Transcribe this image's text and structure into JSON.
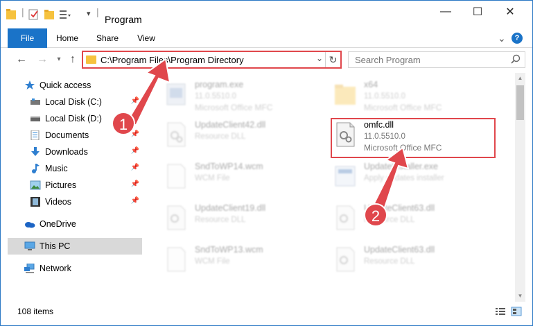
{
  "window": {
    "title": "Program",
    "minimize": "—",
    "maximize": "☐",
    "close": "✕"
  },
  "ribbon": {
    "tabs": [
      "File",
      "Home",
      "Share",
      "View"
    ],
    "help": "?"
  },
  "address": {
    "path": "C:\\Program Files\\Program Directory"
  },
  "search": {
    "placeholder": "Search Program"
  },
  "navpane": {
    "items": [
      {
        "label": "Quick access",
        "icon": "star-icon",
        "pinned": false
      },
      {
        "label": "Local Disk (C:)",
        "icon": "drive-icon",
        "pinned": true
      },
      {
        "label": "Local Disk (D:)",
        "icon": "drive-icon",
        "pinned": true
      },
      {
        "label": "Documents",
        "icon": "documents-icon",
        "pinned": true
      },
      {
        "label": "Downloads",
        "icon": "download-icon",
        "pinned": true
      },
      {
        "label": "Music",
        "icon": "music-icon",
        "pinned": true
      },
      {
        "label": "Pictures",
        "icon": "pictures-icon",
        "pinned": true
      },
      {
        "label": "Videos",
        "icon": "videos-icon",
        "pinned": true
      },
      {
        "label": "OneDrive",
        "icon": "cloud-icon",
        "pinned": false
      },
      {
        "label": "This PC",
        "icon": "computer-icon",
        "pinned": false
      },
      {
        "label": "Network",
        "icon": "network-icon",
        "pinned": false
      }
    ],
    "selected": "This PC"
  },
  "files": [
    {
      "name": "program.exe",
      "line2": "11.0.5510.0",
      "line3": "Microsoft Office MFC",
      "icon": "exe-icon",
      "focused": false
    },
    {
      "name": "x64",
      "line2": "11.0.5510.0",
      "line3": "Microsoft Office MFC",
      "icon": "folder-icon",
      "focused": false
    },
    {
      "name": "UpdateClient42.dll",
      "line2": "Resource DLL",
      "line3": "",
      "icon": "dll-icon",
      "focused": false
    },
    {
      "name": "omfc.dll",
      "line2": "11.0.5510.0",
      "line3": "Microsoft Office MFC",
      "icon": "dll-icon",
      "focused": true
    },
    {
      "name": "SndToWP14.wcm",
      "line2": "WCM File",
      "line3": "",
      "icon": "file-icon",
      "focused": false
    },
    {
      "name": "UpdateInstaller.exe",
      "line2": "Apply updates installer",
      "line3": "",
      "icon": "installer-icon",
      "focused": false
    },
    {
      "name": "UpdateClient19.dll",
      "line2": "Resource DLL",
      "line3": "",
      "icon": "dll-icon",
      "focused": false
    },
    {
      "name": "UpdateClient63.dll",
      "line2": "Resource DLL",
      "line3": "",
      "icon": "dll-icon",
      "focused": false
    },
    {
      "name": "SndToWP13.wcm",
      "line2": "WCM File",
      "line3": "",
      "icon": "file-icon",
      "focused": false
    },
    {
      "name": "UpdateClient63.dll",
      "line2": "Resource DLL",
      "line3": "",
      "icon": "dll-icon",
      "focused": false
    }
  ],
  "status": {
    "count": "108 items"
  },
  "callouts": [
    "1",
    "2"
  ],
  "colors": {
    "accent": "#1a73c8",
    "highlight": "#e0474c",
    "folder": "#f6c23e"
  }
}
